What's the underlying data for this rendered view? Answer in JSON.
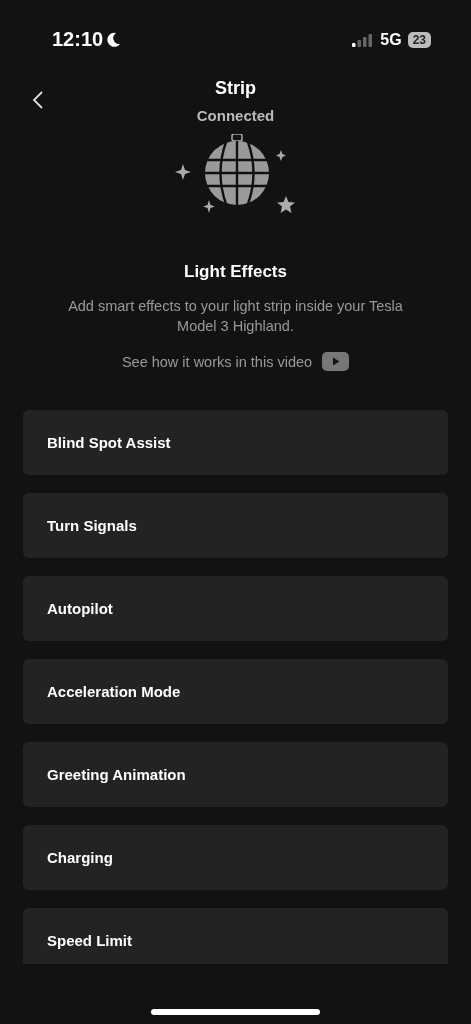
{
  "status_bar": {
    "time": "12:10",
    "network": "5G",
    "battery": "23"
  },
  "header": {
    "title": "Strip",
    "subtitle": "Connected"
  },
  "intro": {
    "heading": "Light Effects",
    "description": "Add smart effects to your light strip inside your Tesla Model 3 Highland.",
    "video_link": "See how it works in this video"
  },
  "effects": [
    {
      "label": "Blind Spot Assist"
    },
    {
      "label": "Turn Signals"
    },
    {
      "label": "Autopilot"
    },
    {
      "label": "Acceleration Mode"
    },
    {
      "label": "Greeting Animation"
    },
    {
      "label": "Charging"
    },
    {
      "label": "Speed Limit"
    }
  ]
}
